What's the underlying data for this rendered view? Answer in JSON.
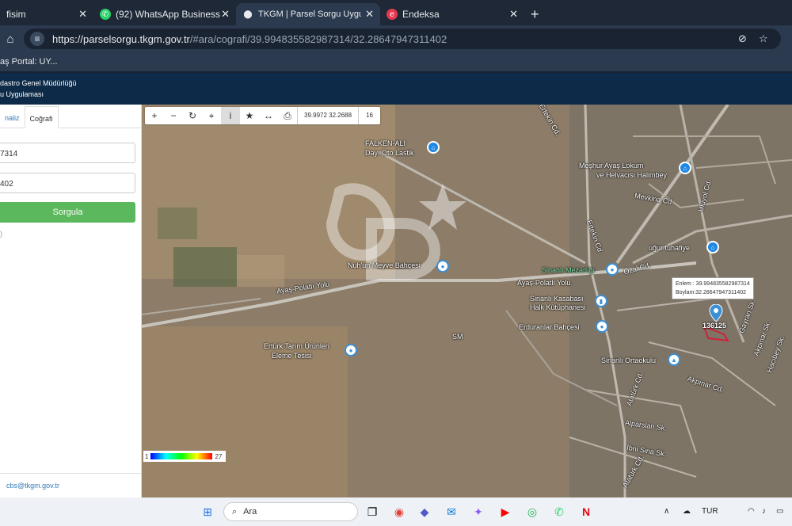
{
  "browser": {
    "tabs": [
      {
        "title": "fisim",
        "active": false
      },
      {
        "title": "(92) WhatsApp Business",
        "active": false
      },
      {
        "title": "TKGM | Parsel Sorgu Uygulaması",
        "active": true
      },
      {
        "title": "Endeksa",
        "active": false
      }
    ],
    "new_tab": "+",
    "url_host": "https://parselsorgu.tkgm.gov.tr",
    "url_path": "/#ara/cografi/39.994835582987314/32.28647947311402",
    "bookmark": "aş Portal: UY..."
  },
  "site": {
    "header_line1": "dastro Genel Müdürlüğü",
    "header_line2": "u Uygulaması"
  },
  "panel": {
    "tab_analiz": "naliz",
    "tab_cografi": "Coğrafi",
    "lat_value": "7314",
    "lon_value": "402",
    "sorgula_label": "Sorgula",
    "note": ")",
    "email": "cbs@tkgm.gov.tr"
  },
  "map": {
    "coords": "39.9972  32.2688",
    "zoom": "16",
    "popup_lat": "Enlem : 39.994835582987314",
    "popup_lon": "Boylam:32.28647947311402",
    "parcel_id": "136125",
    "legend_min": "1",
    "legend_max": "27",
    "labels": {
      "falken": "FALKEN-ALI",
      "dayi": "Dayı Oto Lastik",
      "ertekin": "Ertekin Cd.",
      "ertekin2": "Ertekin Cd.",
      "meshur1": "Meşhur Ayaş Lokum",
      "meshur2": "ve Helvacısı Halimbey",
      "mevkina": "Mevkina Cd.",
      "uluyol": "Uluyol Cd.",
      "ugur": "uğur tuhafiye",
      "nuhun": "Nuh'un Meyve Bahçesi",
      "sinanli_mez": "Sinanlı Mezarlığı",
      "ozal": "Özal Cd.",
      "ayas1": "Ayaş-Polatlı Yolu",
      "ayas2": "Ayaş-Polatlı Yolu",
      "kasaba1": "Sinanlı Kasabası",
      "kasaba2": "Halk Kütüphanesi",
      "erduran": "Erduranlar Bahçesi",
      "erturk1": "Ertürk Tarım Ürünleri",
      "erturk2": "Eleme Tesisi",
      "ortaokul": "Sinanlı Ortaokulu",
      "akpinar": "Akpınar Cd.",
      "ataturk": "Atatürk Cd.",
      "ataturk2": "Atatürk Cd.",
      "alparslan": "Alparslan Sk.",
      "ibni": "İbni Sina Sk.",
      "gayran": "Gayran Sk.",
      "hacibey": "Hacıbey Sk.",
      "aksoy": "Akpınar Sk.",
      "sm": "SM"
    }
  },
  "taskbar": {
    "search_placeholder": "Ara",
    "lang": "TUR"
  }
}
